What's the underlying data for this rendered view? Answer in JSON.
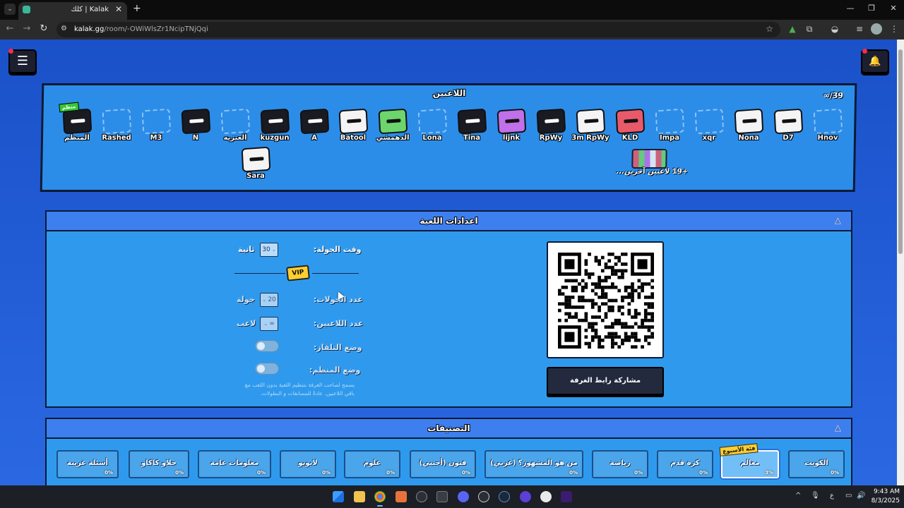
{
  "browser": {
    "tab_title": "Kalak | كلك",
    "url_host": "kalak.gg",
    "url_path": "/room/-OWiWlsZr1NcipTNjQqi",
    "new_tab": "+",
    "tab_close": "✕",
    "min": "—",
    "max": "❐",
    "close": "✕"
  },
  "header": {
    "menu_icon": "☰",
    "bell_icon": "🔔"
  },
  "players": {
    "title": "اللاعبين",
    "count": "∞/39",
    "host_badge": "منظم",
    "list": [
      {
        "name": "المنظم",
        "style": "dark"
      },
      {
        "name": "Rashed",
        "style": "empty"
      },
      {
        "name": "M3",
        "style": "empty"
      },
      {
        "name": "N",
        "style": "dark"
      },
      {
        "name": "العنزيه",
        "style": "empty"
      },
      {
        "name": "kuzgun",
        "style": "dark"
      },
      {
        "name": "A",
        "style": "dark"
      },
      {
        "name": "Batool",
        "style": "light"
      },
      {
        "name": "الدهمشي",
        "style": "green"
      },
      {
        "name": "Lona",
        "style": "empty"
      },
      {
        "name": "Tina",
        "style": "dark"
      },
      {
        "name": "lijnk",
        "style": "purple"
      },
      {
        "name": "RpWy",
        "style": "dark"
      },
      {
        "name": "3m RpWy",
        "style": "light"
      },
      {
        "name": "KLD",
        "style": "red"
      },
      {
        "name": "Impa",
        "style": "empty"
      },
      {
        "name": "xqr",
        "style": "empty"
      },
      {
        "name": "Nona",
        "style": "light"
      },
      {
        "name": "D7",
        "style": "light"
      },
      {
        "name": "Hnov",
        "style": "empty"
      },
      {
        "name": "Sara",
        "style": "light"
      }
    ],
    "more_label": "+19 لاعبين آخرين..."
  },
  "settings": {
    "title": "اعدادات اللعبة",
    "collapse_icon": "△",
    "round_time_label": "وقت الجولة:",
    "round_time_value": "30",
    "round_time_unit": "ثانية",
    "vip_badge": "VIP",
    "rounds_label": "عدد الجولات:",
    "rounds_value": "20",
    "rounds_unit": "جولة",
    "players_label": "عدد اللاعبين:",
    "players_value": "∞",
    "players_unit": "لاعب",
    "tv_mode_label": "وضع التلفاز:",
    "host_mode_label": "وضع المنظم:",
    "hint": "يسمح لصاحب الغرفة بتنظيم اللعبة بدون اللعب مع باقي اللاعبين. عادةً للمسابقات و البطولات.",
    "share_button": "مشاركة رابط الغرفة",
    "tv_mode_on": false,
    "host_mode_on": false
  },
  "categories": {
    "title": "التصنيفات",
    "collapse_icon": "△",
    "week_badge": "فئة الأسبوع",
    "items": [
      {
        "label": "الكويت",
        "pct": "0%"
      },
      {
        "label": "معالم",
        "pct": "3%",
        "selected": true
      },
      {
        "label": "كرة قدم",
        "pct": "0%"
      },
      {
        "label": "رياضة",
        "pct": "0%"
      },
      {
        "label": "من هو المشهور؟ (عربي)",
        "pct": "0%"
      },
      {
        "label": "فنون (أجنبي)",
        "pct": "0%"
      },
      {
        "label": "علوم",
        "pct": "0%"
      },
      {
        "label": "لابوبو",
        "pct": "0%"
      },
      {
        "label": "معلومات عامة",
        "pct": "0%"
      },
      {
        "label": "حلاو كاكاو",
        "pct": "0%"
      },
      {
        "label": "أسئلة غريبة",
        "pct": "0%"
      }
    ]
  },
  "taskbar": {
    "time": "9:43 AM",
    "date": "8/3/2025",
    "lang": "ع"
  },
  "colors": {
    "page_bg": "#1f5bd8",
    "panel": "#2f9aed",
    "panel_header": "#3e7ff0",
    "dark_button": "#232a3e",
    "accent_yellow": "#ffcf30"
  }
}
